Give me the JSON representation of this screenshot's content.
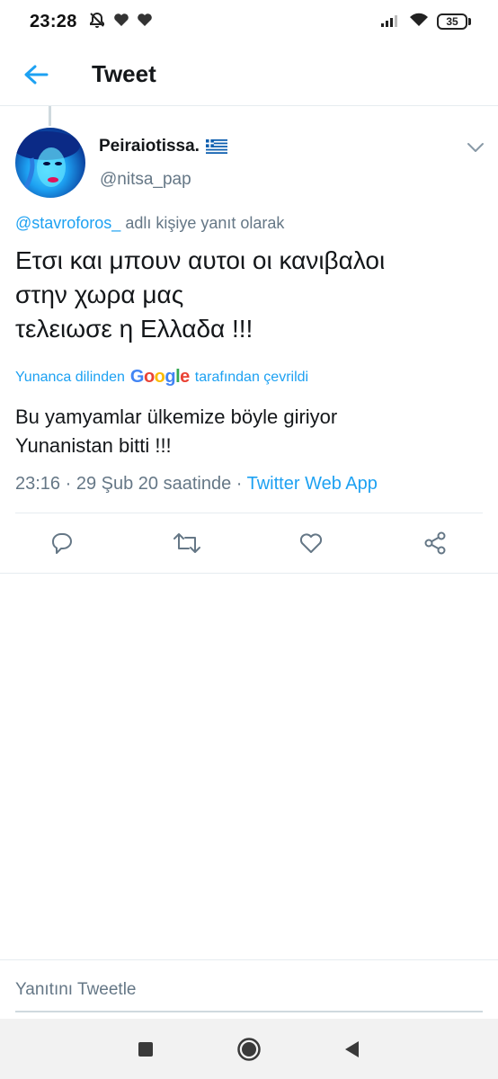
{
  "status_bar": {
    "time": "23:28",
    "battery": "35",
    "icons": [
      "alarm-off-icon",
      "heart-icon",
      "heart-icon",
      "signal-icon",
      "wifi-icon",
      "battery-icon"
    ]
  },
  "header": {
    "title": "Tweet",
    "back_icon": "arrow-left-icon"
  },
  "tweet": {
    "display_name": "Peiraiotissa.",
    "flag": "greek-flag",
    "username": "@nitsa_pap",
    "reply_to_handle": "@stavroforos_",
    "reply_to_suffix": " adlı kişiye yanıt olarak",
    "text": "Ετσι και μπουν αυτοι οι κανιβαλοι\nστην χωρα  μας\nτελειωσε η Ελλαδα  !!!",
    "translation_prefix": "Yunanca dilinden",
    "translation_provider": "Google",
    "translation_suffix": "tarafından çevrildi",
    "translation": "Bu yamyamlar ülkemize böyle giriyor\n Yunanistan bitti !!!",
    "timestamp": "23:16 · 29 Şub 20 saatinde · ",
    "source": "Twitter Web App"
  },
  "actions": [
    "reply-icon",
    "retweet-icon",
    "like-icon",
    "share-icon"
  ],
  "reply_bar": {
    "placeholder": "Yanıtını Tweetle"
  },
  "nav": [
    "recents-button",
    "home-button",
    "back-button"
  ],
  "colors": {
    "accent": "#1da1f2",
    "secondary_text": "#657786",
    "divider": "#e6ecf0",
    "nav_bg": "#f2f2f2"
  }
}
